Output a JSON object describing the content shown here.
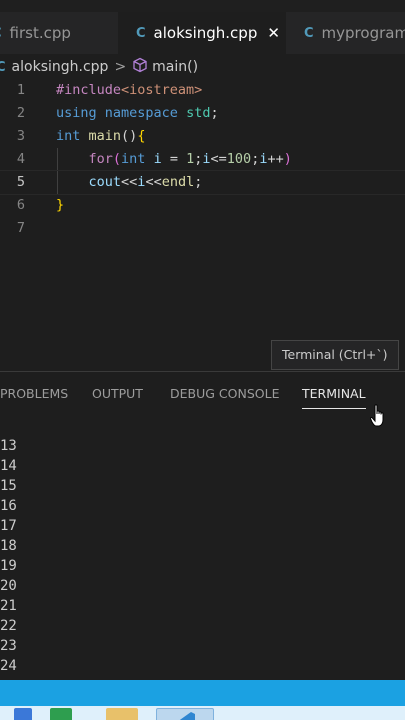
{
  "tabs": [
    {
      "icon": "cpp-icon",
      "badge": "C",
      "label": "first.cpp",
      "active": false
    },
    {
      "icon": "cpp-icon",
      "badge": "C",
      "label": "aloksingh.cpp",
      "active": true
    },
    {
      "icon": "cpp-icon",
      "badge": "C",
      "label": "myprogram",
      "active": false
    }
  ],
  "active_tab_close": "✕",
  "breadcrumb": {
    "file": "aloksingh.cpp",
    "separator": ">",
    "symbol": "main()"
  },
  "code": {
    "numbers": [
      "1",
      "2",
      "3",
      "4",
      "5",
      "6",
      "7"
    ],
    "line1": {
      "a": "#include",
      "b": "<iostream>"
    },
    "line2": {
      "a": "using",
      "b": "namespace",
      "c": "std",
      "d": ";"
    },
    "line3": {
      "a": "int",
      "b": "main",
      "c": "()",
      "d": "{"
    },
    "line4": {
      "a": "for",
      "b": "(",
      "c": "int",
      "d": "i",
      "e": " = ",
      "f": "1",
      "g": ";",
      "h": "i",
      "i": "<=",
      "j": "100",
      "k": ";",
      "l": "i",
      "m": "++",
      "n": ")"
    },
    "line5": {
      "a": "cout",
      "b": "<<",
      "c": "i",
      "d": "<<",
      "e": "endl",
      "f": ";"
    },
    "line6": {
      "a": "}"
    },
    "current_line": 5
  },
  "tooltip": "Terminal (Ctrl+`)",
  "panel_tabs": [
    "PROBLEMS",
    "OUTPUT",
    "DEBUG CONSOLE",
    "TERMINAL"
  ],
  "active_panel_tab": "TERMINAL",
  "terminal_lines": [
    "13",
    "14",
    "15",
    "16",
    "17",
    "18",
    "19",
    "20",
    "21",
    "22",
    "23",
    "24"
  ],
  "colors": {
    "accent_status": "#1ba1e2",
    "editor_bg": "#1e1e1e",
    "cpp_icon": "#519aba"
  }
}
